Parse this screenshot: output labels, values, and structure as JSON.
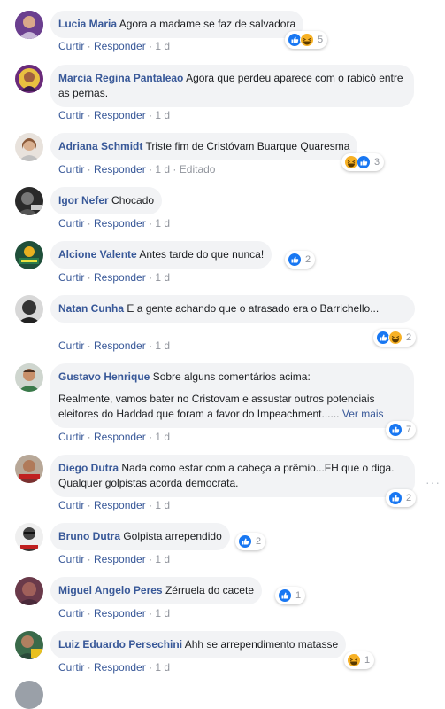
{
  "labels": {
    "like": "Curtir",
    "reply": "Responder",
    "edited": "Editado",
    "see_more": "Ver mais"
  },
  "comments": [
    {
      "author": "Lucia Maria",
      "text": "Agora a madame se faz de salvadora",
      "time": "1 d",
      "reactions": [
        "like",
        "haha"
      ],
      "count": "5"
    },
    {
      "author": "Marcia Regina Pantaleao",
      "text": "Agora que perdeu aparece com o rabicó entre as pernas.",
      "time": "1 d"
    },
    {
      "author": "Adriana Schmidt",
      "text": "Triste fim de Cristóvam Buarque Quaresma",
      "time": "1 d",
      "edited": true,
      "reactions": [
        "haha",
        "like"
      ],
      "count": "3"
    },
    {
      "author": "Igor Nefer",
      "text": "Chocado",
      "time": "1 d"
    },
    {
      "author": "Alcione Valente",
      "text": "Antes tarde do que nunca!",
      "time": "1 d",
      "reactions": [
        "like"
      ],
      "count": "2"
    },
    {
      "author": "Natan Cunha",
      "text": "E a gente achando que o atrasado era o Barrichello...",
      "time": "1 d",
      "reactions": [
        "like",
        "haha"
      ],
      "count": "2"
    },
    {
      "author": "Gustavo Henrique",
      "text": "Sobre alguns comentários acima:",
      "text2": "Realmente, vamos bater no Cristovam e assustar outros potenciais eleitores do Haddad que foram a favor do Impeachment......",
      "time": "1 d",
      "reactions": [
        "like"
      ],
      "count": "7"
    },
    {
      "author": "Diego Dutra",
      "text": "Nada como estar com a cabeça a prêmio...FH que o diga. Qualquer golpistas acorda democrata.",
      "time": "1 d",
      "reactions": [
        "like"
      ],
      "count": "2"
    },
    {
      "author": "Bruno Dutra",
      "text": "Golpista arrependido",
      "time": "1 d",
      "reactions": [
        "like"
      ],
      "count": "2"
    },
    {
      "author": "Miguel Angelo Peres",
      "text": "Zérruela do cacete",
      "time": "1 d",
      "reactions": [
        "like"
      ],
      "count": "1"
    },
    {
      "author": "Luiz Eduardo Persechini",
      "text": "Ahh se arrependimento matasse",
      "time": "1 d",
      "reactions": [
        "haha"
      ],
      "count": "1"
    }
  ],
  "colors": {
    "bubble": "#f2f3f5",
    "author": "#385898",
    "meta": "#90949c",
    "like_blue": "#1877f2",
    "haha_yellow": "#f7b125"
  }
}
